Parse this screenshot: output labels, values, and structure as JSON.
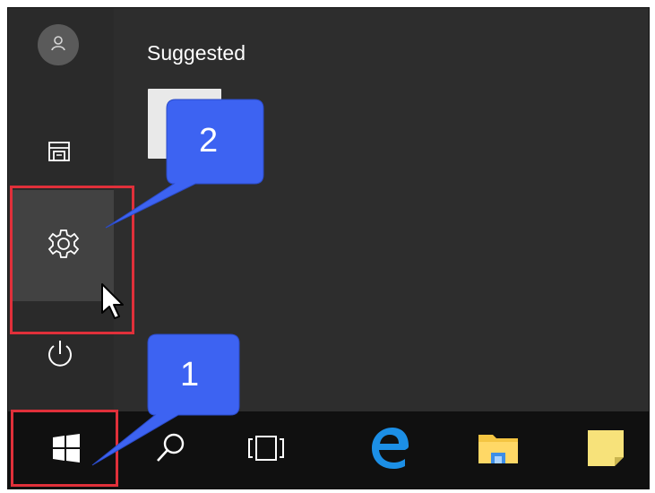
{
  "start_menu": {
    "section_title": "Suggested",
    "rail": {
      "user_icon": "person-icon",
      "documents_icon": "documents-icon",
      "settings_icon": "gear-icon",
      "power_icon": "power-icon"
    }
  },
  "taskbar": {
    "items": [
      {
        "name": "start",
        "icon": "windows-logo-icon"
      },
      {
        "name": "search",
        "icon": "search-icon"
      },
      {
        "name": "task-view",
        "icon": "task-view-icon"
      },
      {
        "name": "edge",
        "icon": "edge-browser-icon"
      },
      {
        "name": "file-explorer",
        "icon": "folder-icon"
      },
      {
        "name": "sticky-notes",
        "icon": "sticky-note-icon"
      }
    ]
  },
  "annotations": {
    "callout_1": "1",
    "callout_2": "2",
    "highlight_color": "#e0303a",
    "callout_color": "#3d63f2"
  }
}
